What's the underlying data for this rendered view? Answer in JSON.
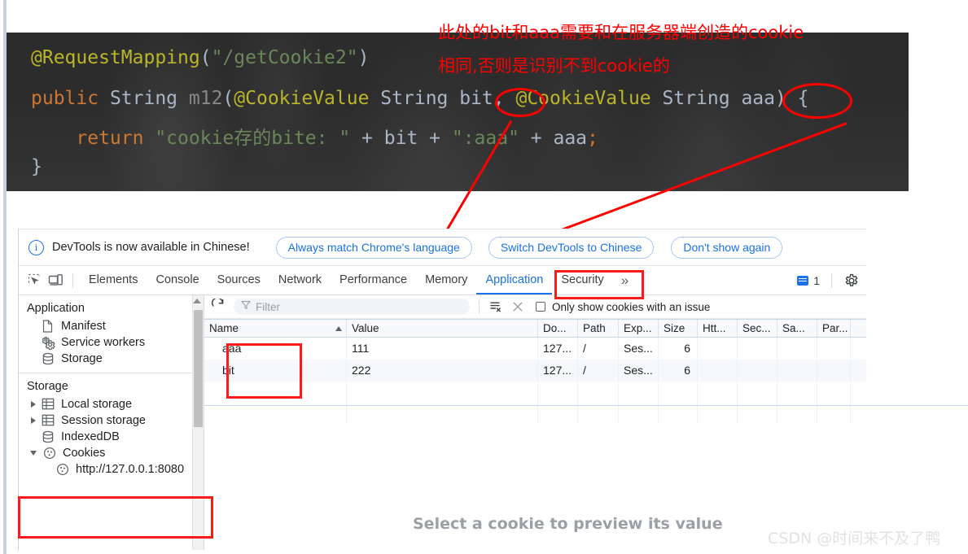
{
  "annotations": {
    "note_line1": "此处的bit和aaa需要和在服务器端创造的cookie",
    "note_line2": "相同,否则是识别不到cookie的"
  },
  "code": {
    "language": "java",
    "lines": [
      {
        "tokens": [
          {
            "t": "@RequestMapping",
            "c": "anno"
          },
          {
            "t": "(",
            "c": "paren"
          },
          {
            "t": "\"/getCookie2\"",
            "c": "str"
          },
          {
            "t": ")",
            "c": "paren"
          }
        ]
      },
      {
        "tokens": [
          {
            "t": "public ",
            "c": "kw"
          },
          {
            "t": "String ",
            "c": "type"
          },
          {
            "t": "m12",
            "c": "method"
          },
          {
            "t": "(",
            "c": "paren"
          },
          {
            "t": "@CookieValue",
            "c": "anno"
          },
          {
            "t": " String ",
            "c": "type"
          },
          {
            "t": "bit",
            "c": "ident"
          },
          {
            "t": ", ",
            "c": "paren"
          },
          {
            "t": "@CookieValue",
            "c": "anno"
          },
          {
            "t": " String ",
            "c": "type"
          },
          {
            "t": "aaa",
            "c": "ident"
          },
          {
            "t": ") {",
            "c": "paren"
          }
        ]
      },
      {
        "tokens": [
          {
            "t": "    return ",
            "c": "kw"
          },
          {
            "t": "\"cookie存的bite: \"",
            "c": "str"
          },
          {
            "t": " + ",
            "c": "plus"
          },
          {
            "t": "bit",
            "c": "ident"
          },
          {
            "t": " + ",
            "c": "plus"
          },
          {
            "t": "\":aaa\"",
            "c": "str"
          },
          {
            "t": " + ",
            "c": "plus"
          },
          {
            "t": "aaa",
            "c": "ident"
          },
          {
            "t": ";",
            "c": "semi"
          }
        ]
      },
      {
        "tokens": [
          {
            "t": "}",
            "c": "paren"
          }
        ]
      }
    ]
  },
  "notification": {
    "message": "DevTools is now available in Chinese!",
    "info_icon": "info-circle-icon",
    "buttons": [
      "Always match Chrome's language",
      "Switch DevTools to Chinese",
      "Don't show again"
    ]
  },
  "tabbar": {
    "left_icons": [
      "inspect-element-icon",
      "device-toolbar-icon"
    ],
    "tabs": [
      "Elements",
      "Console",
      "Sources",
      "Network",
      "Performance",
      "Memory",
      "Application",
      "Security"
    ],
    "active_tab": "Application",
    "more_label": "»",
    "message_count": "1",
    "message_icon": "message-icon",
    "settings_icon": "gear-icon",
    "accent_color": "#1a73e8"
  },
  "sidebar": {
    "sections": [
      {
        "title": "Application",
        "items": [
          {
            "label": "Manifest",
            "icon": "document-icon",
            "expandable": false,
            "expanded": false
          },
          {
            "label": "Service workers",
            "icon": "gears-icon",
            "expandable": false,
            "expanded": false
          },
          {
            "label": "Storage",
            "icon": "database-icon",
            "expandable": false,
            "expanded": false
          }
        ]
      },
      {
        "title": "Storage",
        "items": [
          {
            "label": "Local storage",
            "icon": "table-icon",
            "expandable": true,
            "expanded": false
          },
          {
            "label": "Session storage",
            "icon": "table-icon",
            "expandable": true,
            "expanded": false
          },
          {
            "label": "IndexedDB",
            "icon": "database-icon",
            "expandable": false,
            "expanded": false
          },
          {
            "label": "Cookies",
            "icon": "cookie-icon",
            "expandable": true,
            "expanded": true
          }
        ]
      }
    ],
    "cookie_origin": {
      "label": "http://127.0.0.1:8080",
      "icon": "cookie-icon"
    }
  },
  "toolbar": {
    "refresh_icon": "refresh-icon",
    "filter_icon": "funnel-icon",
    "filter_placeholder": "Filter",
    "filter_value": "",
    "clear_all_icon": "clear-all-cookies-icon",
    "delete_icon": "delete-icon",
    "checkbox_label": "Only show cookies with an issue",
    "checkbox_checked": false
  },
  "cookie_table": {
    "columns": [
      "Name",
      "Value",
      "Do...",
      "Path",
      "Exp...",
      "Size",
      "Htt...",
      "Sec...",
      "Sa...",
      "Par..."
    ],
    "sorted_column": "Name",
    "sort_direction": "asc",
    "rows": [
      {
        "Name": "aaa",
        "Value": "111",
        "Do...": "127...",
        "Path": "/",
        "Exp...": "Ses...",
        "Size": "6",
        "Htt...": "",
        "Sec...": "",
        "Sa...": "",
        "Par...": ""
      },
      {
        "Name": "bit",
        "Value": "222",
        "Do...": "127...",
        "Path": "/",
        "Exp...": "Ses...",
        "Size": "6",
        "Htt...": "",
        "Sec...": "",
        "Sa...": "",
        "Par...": ""
      }
    ]
  },
  "preview": {
    "message": "Select a cookie to preview its value"
  },
  "watermark": {
    "text": "CSDN @时间来不及了鸭"
  }
}
